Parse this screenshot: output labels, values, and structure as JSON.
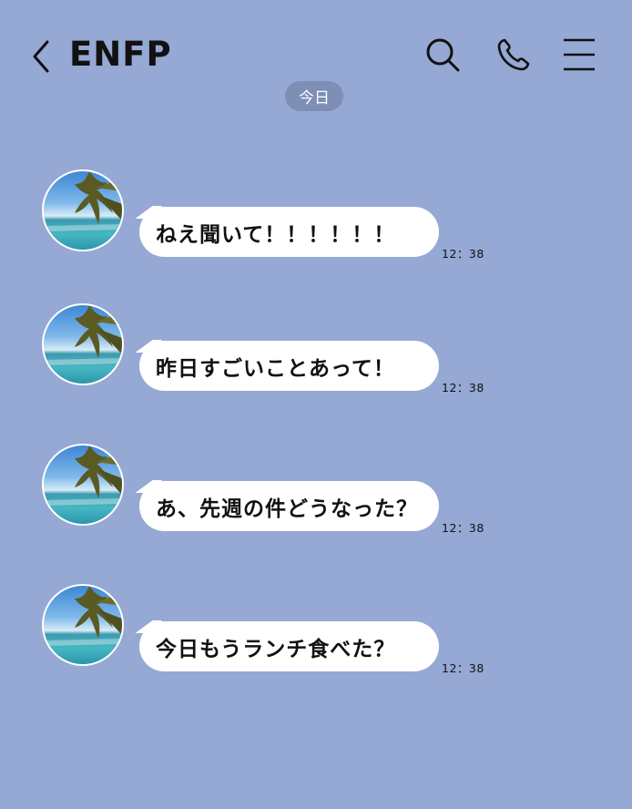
{
  "header": {
    "title": "ENFP",
    "icons": [
      "back-icon",
      "search-icon",
      "phone-icon",
      "menu-icon"
    ]
  },
  "date_separator": "今日",
  "messages": [
    {
      "text": "ねえ聞いて！！！！！！",
      "time": "12：38"
    },
    {
      "text": "昨日すごいことあって！",
      "time": "12：38"
    },
    {
      "text": "あ、先週の件どうなった？",
      "time": "12：38"
    },
    {
      "text": "今日もうランチ食べた？",
      "time": "12：38"
    }
  ],
  "colors": {
    "background": "#96a8d4",
    "bubble": "#ffffff",
    "date_pill": "#7e8fb5",
    "text": "#111111"
  }
}
